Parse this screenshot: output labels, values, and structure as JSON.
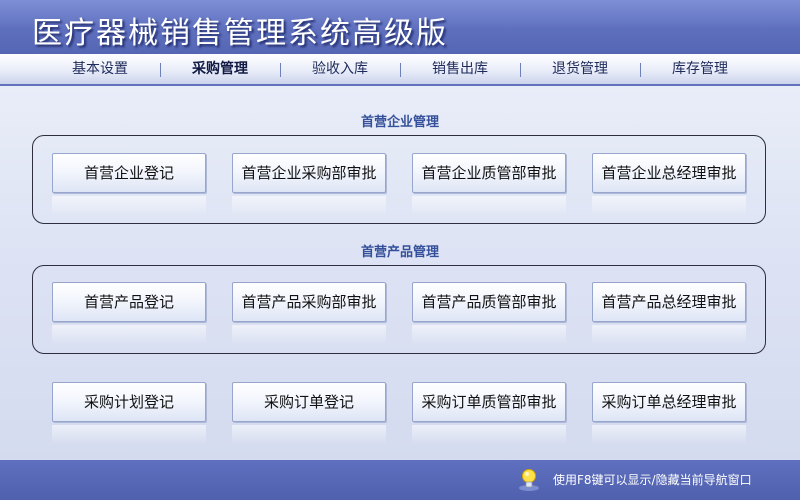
{
  "app": {
    "title": "医疗器械销售管理系统高级版"
  },
  "nav": {
    "items": [
      {
        "label": "基本设置"
      },
      {
        "label": "采购管理"
      },
      {
        "label": "验收入库"
      },
      {
        "label": "销售出库"
      },
      {
        "label": "退货管理"
      },
      {
        "label": "库存管理"
      }
    ],
    "active": "采购管理"
  },
  "sections": {
    "enterprise": {
      "title": "首营企业管理",
      "buttons": [
        "首营企业登记",
        "首营企业采购部审批",
        "首营企业质管部审批",
        "首营企业总经理审批"
      ]
    },
    "product": {
      "title": "首营产品管理",
      "buttons": [
        "首营产品登记",
        "首营产品采购部审批",
        "首营产品质管部审批",
        "首营产品总经理审批"
      ]
    },
    "order": {
      "buttons": [
        "采购计划登记",
        "采购订单登记",
        "采购订单质管部审批",
        "采购订单总经理审批"
      ]
    }
  },
  "footer": {
    "icon": "lightbulb-icon",
    "hint": "使用F8键可以显示/隐藏当前导航窗口"
  }
}
